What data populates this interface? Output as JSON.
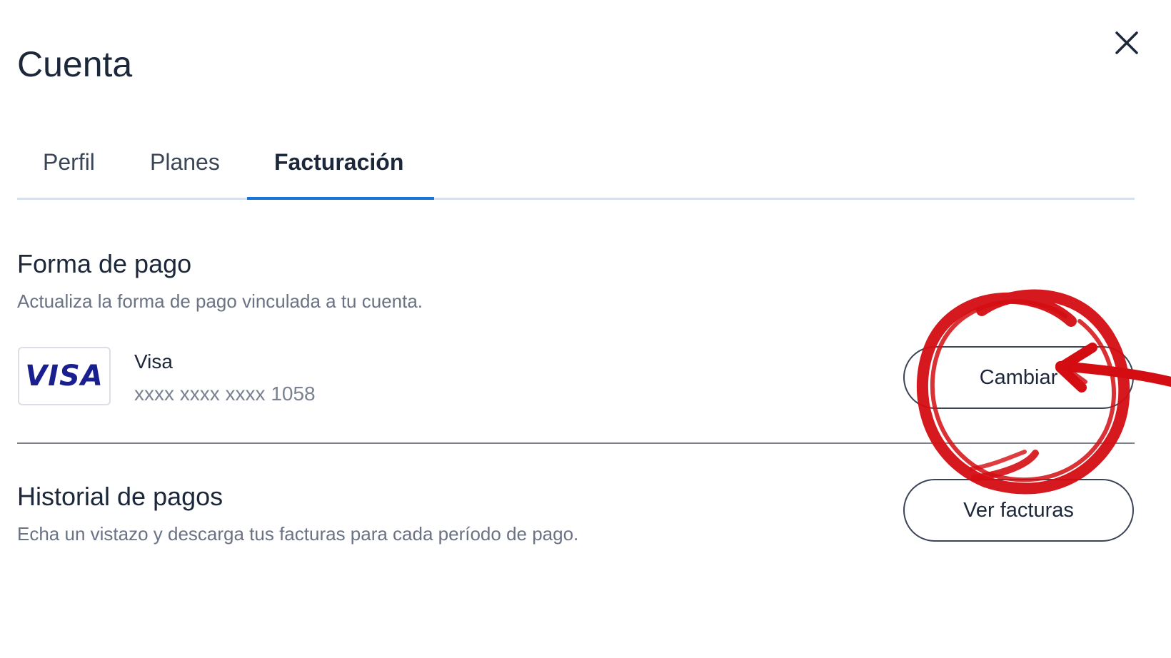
{
  "header": {
    "title": "Cuenta",
    "close_icon": "close-icon"
  },
  "tabs": [
    {
      "label": "Perfil",
      "active": false
    },
    {
      "label": "Planes",
      "active": false
    },
    {
      "label": "Facturación",
      "active": true
    }
  ],
  "payment_method": {
    "title": "Forma de pago",
    "description": "Actualiza la forma de pago vinculada a tu cuenta.",
    "card": {
      "logo_text": "VISA",
      "brand": "Visa",
      "number": "xxxx xxxx xxxx 1058"
    },
    "change_button": "Cambiar"
  },
  "payment_history": {
    "title": "Historial de pagos",
    "description": "Echa un vistazo y descarga tus facturas para cada período de pago.",
    "view_invoices_button": "Ver facturas"
  },
  "colors": {
    "accent": "#1a73d9",
    "tab_rail": "#cfe2f6",
    "visa_blue": "#1a1f8f",
    "annotation_red": "#d40d12"
  }
}
